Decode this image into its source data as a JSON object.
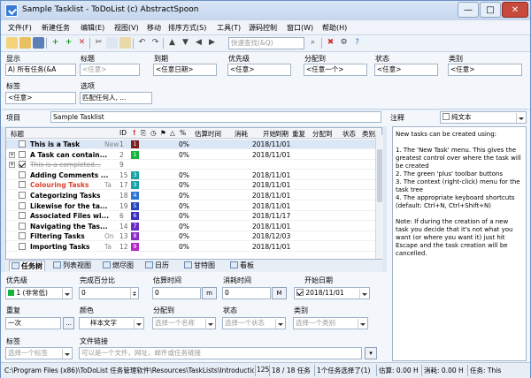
{
  "window": {
    "title": "Sample Tasklist - ToDoList (c) AbstractSpoon"
  },
  "menu": [
    "文件(F)",
    "新建任务",
    "编辑(E)",
    "视图(V)",
    "移动",
    "排序方式(S)",
    "工具(T)",
    "源码控制",
    "窗口(W)",
    "帮助(H)"
  ],
  "toolbar": {
    "search_placeholder": "快速查找(&Q)"
  },
  "filters": {
    "show_label": "显示",
    "show_value": "A) 所有任务(&A",
    "title_label": "标题",
    "title_placeholder": "<任意>",
    "due_label": "到期",
    "due_value": "<任意日期>",
    "priority_label": "优先级",
    "priority_value": "<任意>",
    "alloc_label": "分配到",
    "alloc_value": "<任意一个>",
    "status_label": "状态",
    "status_value": "<任意>",
    "category_label": "类别",
    "category_value": "<任意>",
    "tags_label": "标签",
    "tags_value": "<任意>",
    "options_label": "选项",
    "options_value": "匹配任何人, ..."
  },
  "project": {
    "label": "项目",
    "value": "Sample Tasklist"
  },
  "tree": {
    "headers": [
      "标题",
      "ID",
      "!",
      "",
      "",
      "",
      "%",
      "估算时间",
      "消耗",
      "开始",
      "到期",
      "重复",
      "分配到",
      "状态",
      "类别"
    ],
    "rows": [
      {
        "title": "This is a Task",
        "extra": "New",
        "id": "1",
        "pri": "1",
        "pri_color": "#7a2020",
        "pct": "0%",
        "start": "2018/11/01",
        "style": "bold",
        "expander": "",
        "checked": false
      },
      {
        "title": "A Task can contain...",
        "extra": "",
        "id": "2",
        "pri": "1",
        "pri_color": "#12b53a",
        "pct": "0%",
        "start": "2018/11/01",
        "style": "bold",
        "expander": "+",
        "checked": false
      },
      {
        "title": "This is a completed...",
        "extra": "",
        "id": "9",
        "pri": "",
        "pri_color": "",
        "pct": "",
        "start": "",
        "style": "done",
        "expander": "+",
        "checked": true
      },
      {
        "title": "Adding Comments ...",
        "extra": "",
        "id": "15",
        "pri": "3",
        "pri_color": "#1aa3a3",
        "pct": "0%",
        "start": "2018/11/01",
        "style": "bold",
        "expander": "",
        "checked": false
      },
      {
        "title": "Colouring Tasks",
        "extra": "Ta",
        "id": "17",
        "pri": "3",
        "pri_color": "#1aa3a3",
        "pct": "0%",
        "start": "2018/11/01",
        "style": "red",
        "expander": "",
        "checked": false
      },
      {
        "title": "Categorizing Tasks",
        "extra": "",
        "id": "18",
        "pri": "4",
        "pri_color": "#2b74d8",
        "pct": "0%",
        "start": "2018/11/01",
        "style": "bold",
        "expander": "",
        "checked": false
      },
      {
        "title": "Likewise for the ta...",
        "extra": "",
        "id": "19",
        "pri": "5",
        "pri_color": "#2748b8",
        "pct": "0%",
        "start": "2018/11/01",
        "style": "bold",
        "expander": "",
        "checked": false
      },
      {
        "title": "Associated Files wi...",
        "extra": "",
        "id": "6",
        "pri": "6",
        "pri_color": "#3b2ec0",
        "pct": "0%",
        "start": "2018/11/17",
        "style": "bold",
        "expander": "",
        "checked": false
      },
      {
        "title": "Navigating the Tas...",
        "extra": "",
        "id": "14",
        "pri": "7",
        "pri_color": "#6b2bc4",
        "pct": "0%",
        "start": "2018/11/01",
        "style": "bold",
        "expander": "",
        "checked": false
      },
      {
        "title": "Filtering Tasks",
        "extra": "On",
        "id": "13",
        "pri": "8",
        "pri_color": "#8a2bc4",
        "pct": "0%",
        "start": "2018/12/03",
        "style": "bold",
        "expander": "",
        "checked": false
      },
      {
        "title": "Importing Tasks",
        "extra": "Ta",
        "id": "12",
        "pri": "9",
        "pri_color": "#b32bc4",
        "pct": "0%",
        "start": "2018/11/01",
        "style": "bold",
        "expander": "",
        "checked": false
      }
    ]
  },
  "tabs": [
    "任务树",
    "列表视图",
    "燃尽图",
    "日历",
    "甘特图",
    "看板"
  ],
  "attrs": {
    "priority_label": "优先级",
    "priority_value": "1 (非常低)",
    "pct_label": "完成百分比",
    "pct_value": "0",
    "est_label": "估算时间",
    "est_value": "0",
    "est_unit": "m",
    "spent_label": "消耗时间",
    "spent_value": "0",
    "spent_unit": "M",
    "start_label": "开始日期",
    "start_value": "2018/11/01",
    "repeat_label": "重复",
    "repeat_value": "一次",
    "color_label": "颜色",
    "color_value": "样本文字",
    "alloc_label": "分配到",
    "alloc_value": "选择一个名称",
    "status_label": "状态",
    "status_value": "选择一个状态",
    "category_label": "类别",
    "category_value": "选择一个类别",
    "tags_label": "标签",
    "tags_value": "选择一个标签",
    "filelink_label": "文件链接",
    "filelink_value": "可以是一个文件，网址，邮件或任务链接"
  },
  "notes": {
    "label": "注释",
    "format": "纯文本",
    "text": "New tasks can be created using:\n\n1. The 'New Task' menu. This gives the greatest control over where the task will be created\n2. The green 'plus' toolbar buttons\n3. The context (right-click) menu for the task tree\n4. The appropriate keyboard shortcuts (default: Ctrl+N, Ctrl+Shift+N)\n\nNote: If during the creation of a new task you decide that it's not what you want (or where you want it) just hit Escape and the task creation will be cancelled."
  },
  "status": {
    "path": "C:\\Program Files (x86)\\ToDoList 任务管理软件\\Resources\\TaskLists\\Introduction.tdl",
    "count": "125",
    "visible": "18 / 18 任务",
    "selected": "1个任务选择了(1)",
    "estimated": "估算: 0.00 H",
    "spent": "消耗: 0.00 H",
    "task": "任务: This"
  }
}
